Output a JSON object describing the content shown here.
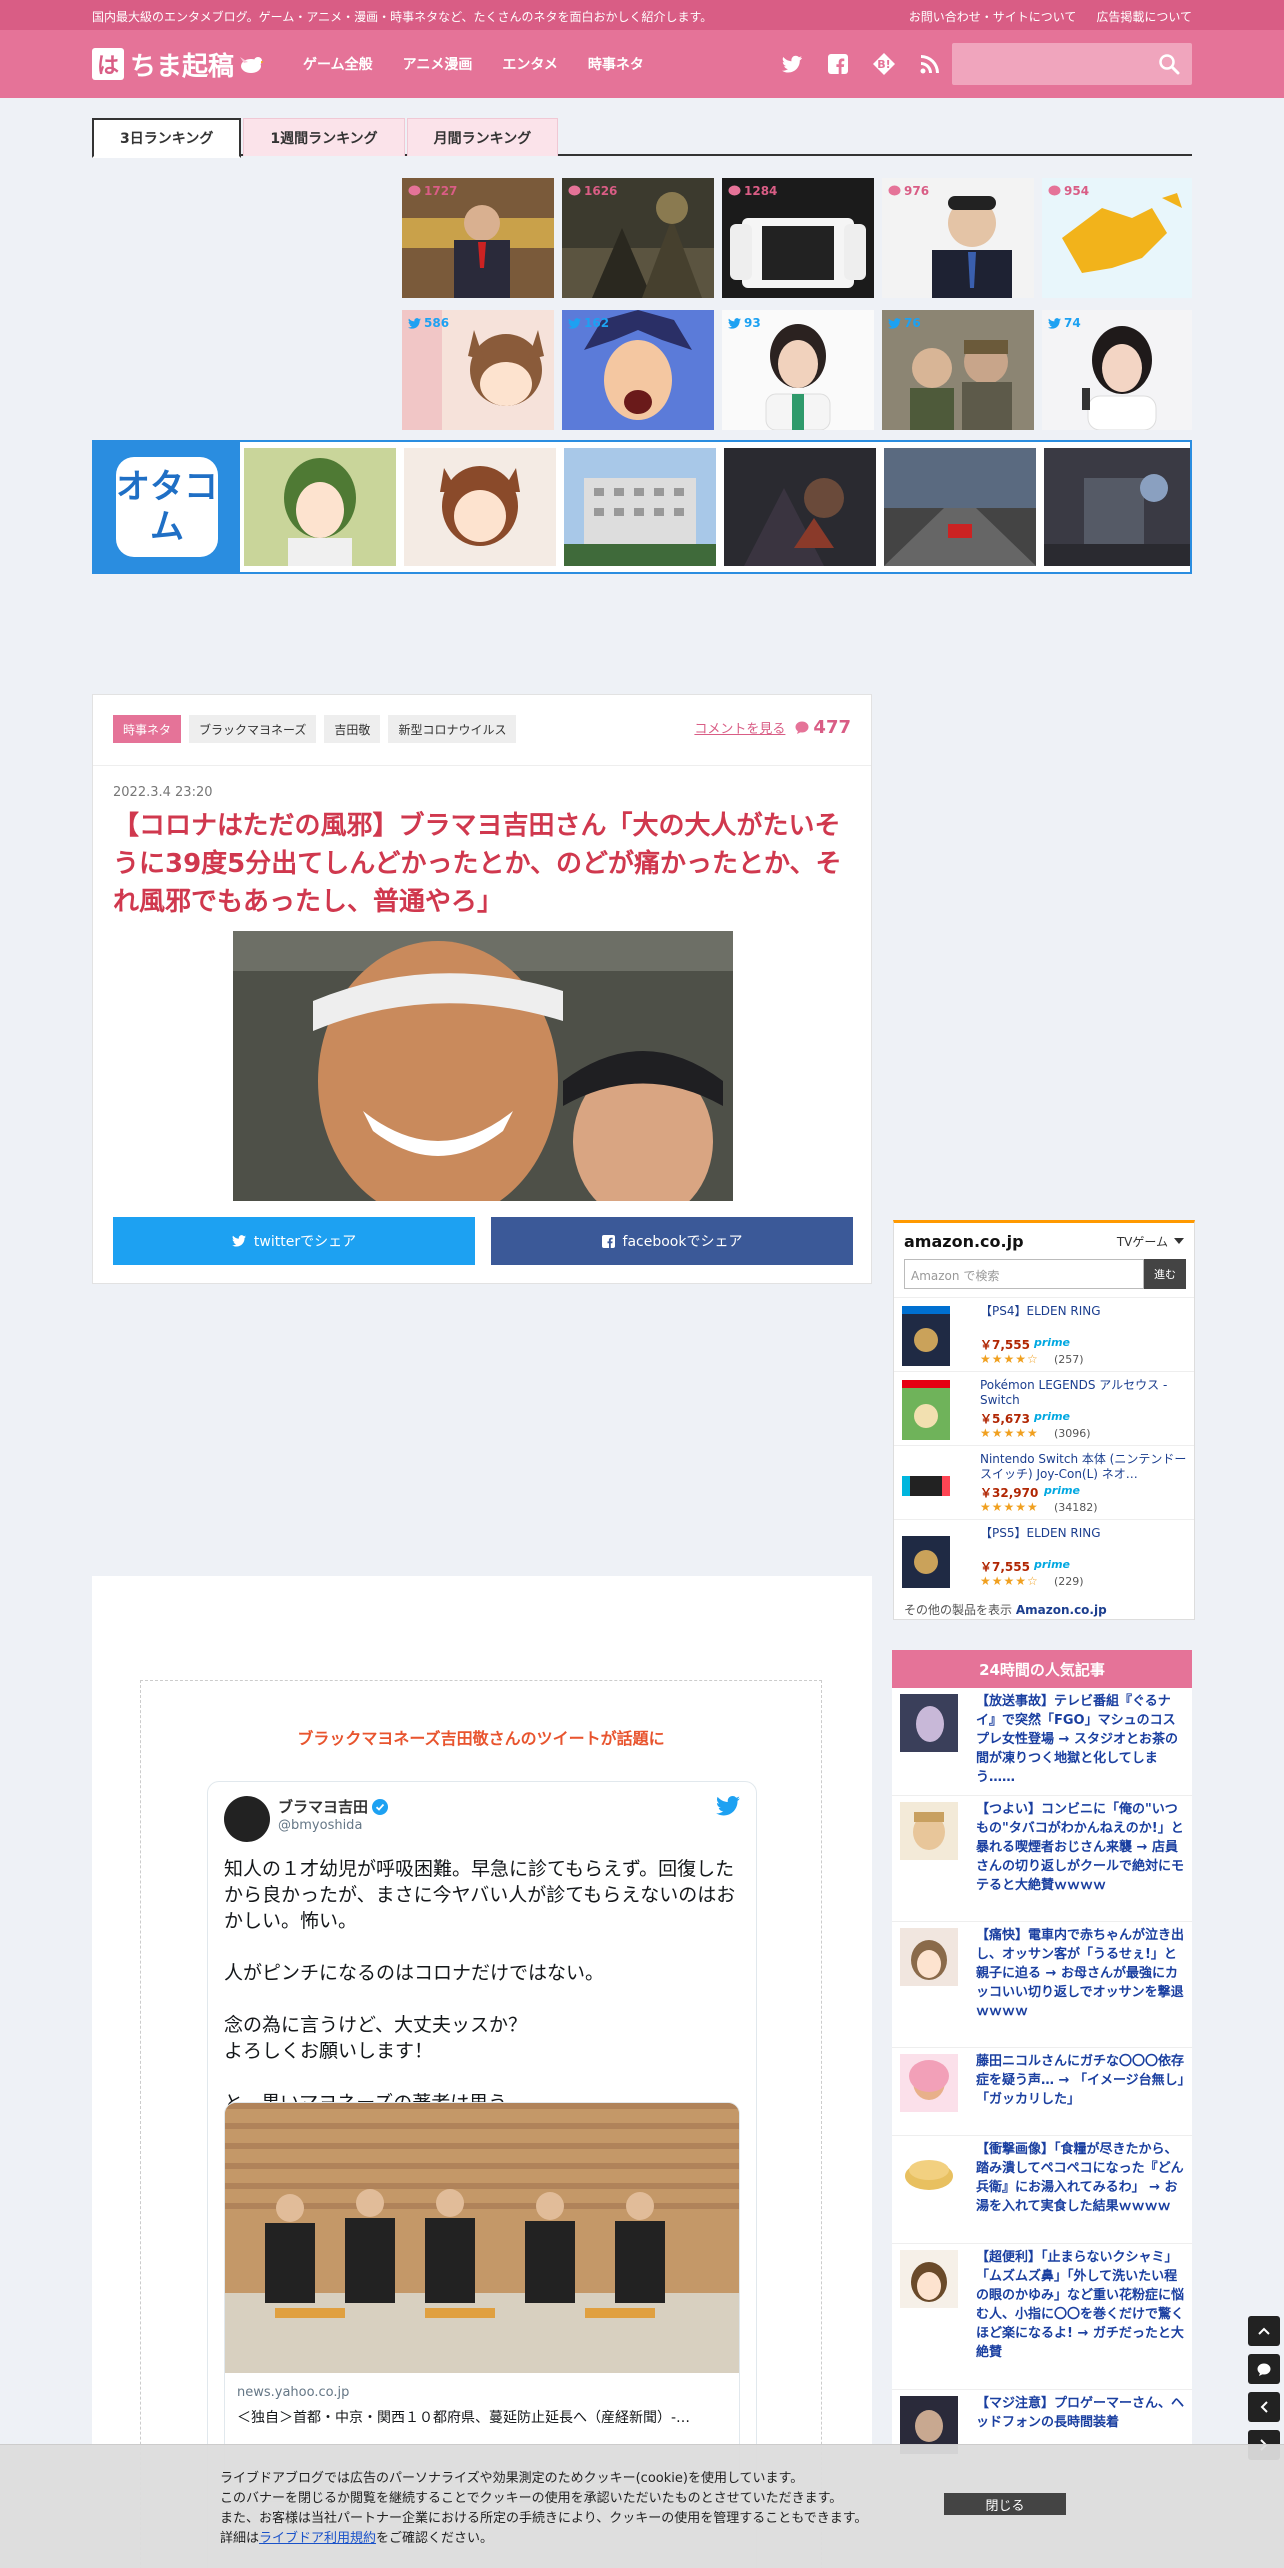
{
  "topbar": {
    "tagline": "国内最大級のエンタメブログ。ゲーム・アニメ・漫画・時事ネタなど、たくさんのネタを面白おかしく紹介します。",
    "contact": "お問い合わせ・サイトについて",
    "ads": "広告掲載について"
  },
  "header": {
    "logo_mark": "は",
    "logo_text": "ちま起稿",
    "nav": [
      "ゲーム全般",
      "アニメ漫画",
      "エンタメ",
      "時事ネタ"
    ]
  },
  "ranking": {
    "tabs": [
      "3日ランキング",
      "1週間ランキング",
      "月間ランキング"
    ],
    "comment_counts": [
      "1727",
      "1626",
      "1284",
      "976",
      "954"
    ],
    "tweet_counts": [
      "586",
      "162",
      "93",
      "76",
      "74"
    ]
  },
  "otacom": {
    "logo": "オタコム"
  },
  "article": {
    "tags": [
      "時事ネタ",
      "ブラックマヨネーズ",
      "吉田敬",
      "新型コロナウイルス"
    ],
    "comment_link": "コメントを見る",
    "comment_count": "477",
    "date": "2022.3.4 23:20",
    "title": "【コロナはただの風邪】ブラマヨ吉田さん「大の大人がたいそうに39度5分出てしんどかったとか、のどが痛かったとか、それ風邪でもあったし、普通やろ」",
    "twitter_share": "twitterでシェア",
    "facebook_share": "facebookでシェア"
  },
  "quote": {
    "heading": "ブラックマヨネーズ吉田敬さんのツイートが話題に",
    "tweet_name": "ブラマヨ吉田",
    "tweet_handle": "@bmyoshida",
    "tweet_text": "知人の１才幼児が呼吸困難。早急に診てもらえず。回復したから良かったが、まさに今ヤバい人が診てもらえないのはおかしい。怖い。\n\n人がピンチになるのはコロナだけではない。\n\n念の為に言うけど、大丈夫ッスか？\nよろしくお願いします！\n\nと、黒いマヨネーズの著者は思う。",
    "card_domain": "news.yahoo.co.jp",
    "card_title": "＜独自＞首都・中京・関西１０都府県、蔓延防止延長へ（産経新聞）‐…"
  },
  "amazon": {
    "logo": "amazon.co.jp",
    "category": "TVゲーム",
    "search_placeholder": "Amazon で検索",
    "search_button": "進む",
    "items": [
      {
        "name": "【PS4】ELDEN RING",
        "price": "￥7,555",
        "prime": "prime",
        "stars": "★★★★☆",
        "reviews": "(257)"
      },
      {
        "name": "Pokémon LEGENDS アルセウス -Switch",
        "price": "￥5,673",
        "prime": "prime",
        "stars": "★★★★★",
        "reviews": "(3096)"
      },
      {
        "name": "Nintendo Switch 本体 (ニンテンドースイッチ) Joy-Con(L) ネオ…",
        "price": "￥32,970",
        "prime": "prime",
        "stars": "★★★★★",
        "reviews": "(34182)"
      },
      {
        "name": "【PS5】ELDEN RING",
        "price": "￥7,555",
        "prime": "prime",
        "stars": "★★★★☆",
        "reviews": "(229)"
      }
    ],
    "more_prefix": "その他の製品を表示",
    "more_site": "Amazon.co.jp"
  },
  "popular": {
    "heading": "24時間の人気記事",
    "items": [
      "【放送事故】テレビ番組『ぐるナイ』で突然「FGO」マシュのコスプレ女性登場 → スタジオとお茶の間が凍りつく地獄と化してしまう……",
      "【つよい】コンビニに「俺の\"いつもの\"タバコがわかんねえのか!」と暴れる喫煙者おじさん来襲 → 店員さんの切り返しがクールで絶対にモテると大絶賛ｗｗｗｗ",
      "【痛快】電車内で赤ちゃんが泣き出し、オッサン客が「うるせぇ!」と親子に迫る → お母さんが最強にカッコいい切り返しでオッサンを撃退ｗｗｗｗ",
      "藤田ニコルさんにガチな〇〇〇依存症を疑う声… → 「イメージ台無し」「ガッカリした」",
      "【衝撃画像】「食糧が尽きたから、踏み潰してペコペコになった『どん兵衛』にお湯入れてみるわ」 → お湯を入れて実食した結果ｗｗｗｗ",
      "【超便利】「止まらないクシャミ」「ムズムズ鼻」「外して洗いたい程の眼のかゆみ」など重い花粉症に悩む人、小指に〇〇を巻くだけで驚くほど楽になるよ! → ガチだったと大絶賛",
      "【マジ注意】プロゲーマーさん、ヘッドフォンの長時間装着"
    ]
  },
  "cookie": {
    "line1": "ライブドアブログでは広告のパーソナライズや効果測定のためクッキー(cookie)を使用しています。",
    "line2": "このバナーを閉じるか閲覧を継続することでクッキーの使用を承認いただいたものとさせていただきます。",
    "line3": "また、お客様は当社パートナー企業における所定の手続きにより、クッキーの使用を管理することもできます。",
    "line4_prefix": "詳細は",
    "line4_link": "ライブドア利用規約",
    "line4_suffix": "をご確認ください。",
    "close": "閉じる"
  }
}
